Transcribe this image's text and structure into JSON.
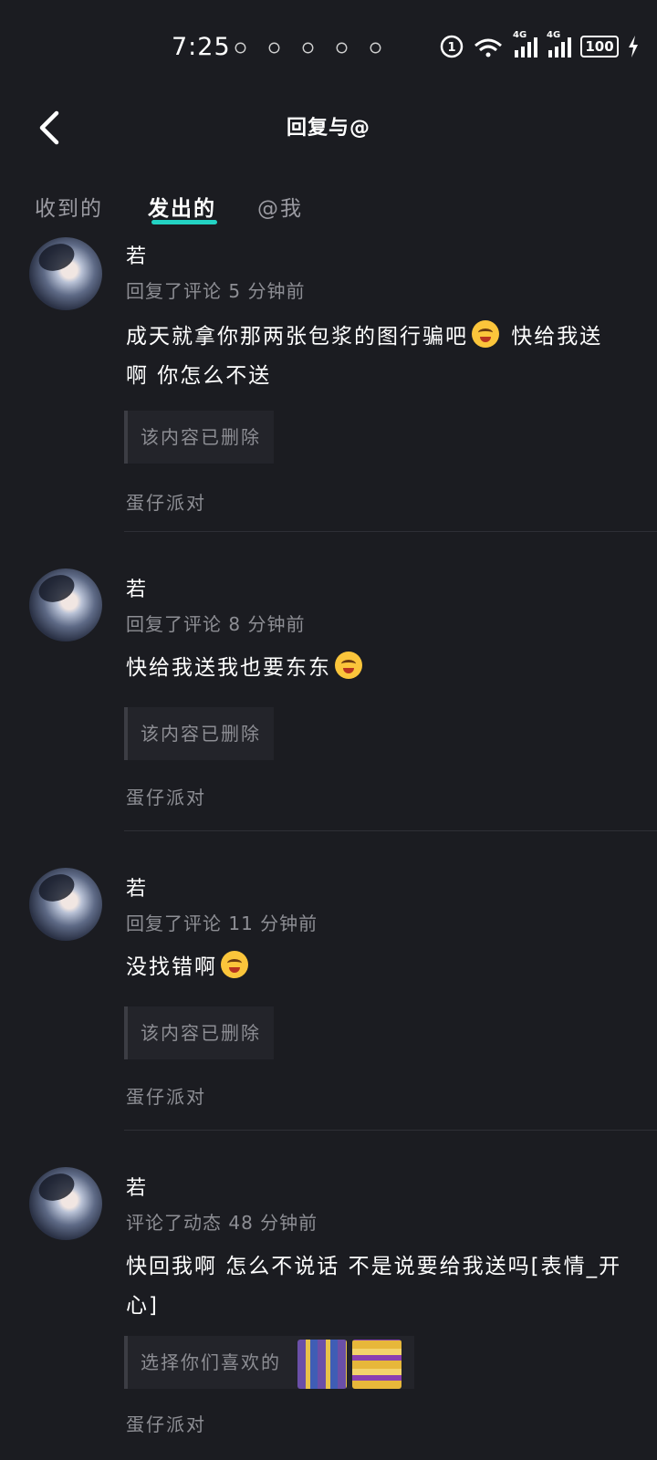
{
  "status_bar": {
    "time": "7:25",
    "network_label": "4G",
    "battery": "100"
  },
  "header": {
    "title": "回复与@"
  },
  "tabs": [
    {
      "label": "收到的",
      "active": false
    },
    {
      "label": "发出的",
      "active": true
    },
    {
      "label": "@我",
      "active": false
    }
  ],
  "accent_color": "#23d2c3",
  "replies": [
    {
      "name": "若",
      "action": "回复了评论",
      "time_ago": "5 分钟前",
      "text_before": "成天就拿你那两张包浆的图行骗吧",
      "emoji": "smile-emoji",
      "text_after": " 快给我送啊 你怎么不送",
      "quote": "该内容已删除",
      "source": "蛋仔派对"
    },
    {
      "name": "若",
      "action": "回复了评论",
      "time_ago": "8 分钟前",
      "text_before": "快给我送我也要东东",
      "emoji": "smile-emoji",
      "text_after": "",
      "quote": "该内容已删除",
      "source": "蛋仔派对"
    },
    {
      "name": "若",
      "action": "回复了评论",
      "time_ago": "11 分钟前",
      "text_before": "没找错啊",
      "emoji": "smile-emoji",
      "text_after": "",
      "quote": "该内容已删除",
      "source": "蛋仔派对"
    },
    {
      "name": "若",
      "action": "评论了动态",
      "time_ago": "48 分钟前",
      "text_before": "快回我啊 怎么不说话 不是说要给我送吗[表情_开心]",
      "text_after": "",
      "quote": "选择你们喜欢的",
      "source": "蛋仔派对"
    }
  ]
}
